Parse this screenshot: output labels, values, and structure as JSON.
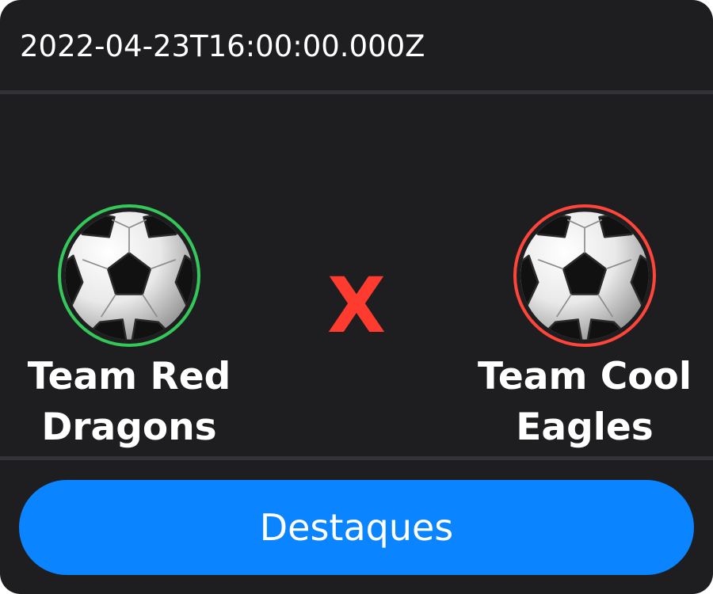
{
  "match": {
    "datetime": "2022-04-23T16:00:00.000Z",
    "versus_symbol": "X"
  },
  "home_team": {
    "name": "Team Red Dragons",
    "logo_icon": "soccer-ball-icon",
    "ring_color": "#34c759"
  },
  "away_team": {
    "name": "Team Cool Eagles",
    "logo_icon": "soccer-ball-icon",
    "ring_color": "#ff453a"
  },
  "actions": {
    "highlights_label": "Destaques"
  },
  "colors": {
    "background": "#1e1e20",
    "divider": "#333337",
    "versus": "#ff3b30",
    "button": "#0a84ff",
    "text": "#ffffff"
  }
}
